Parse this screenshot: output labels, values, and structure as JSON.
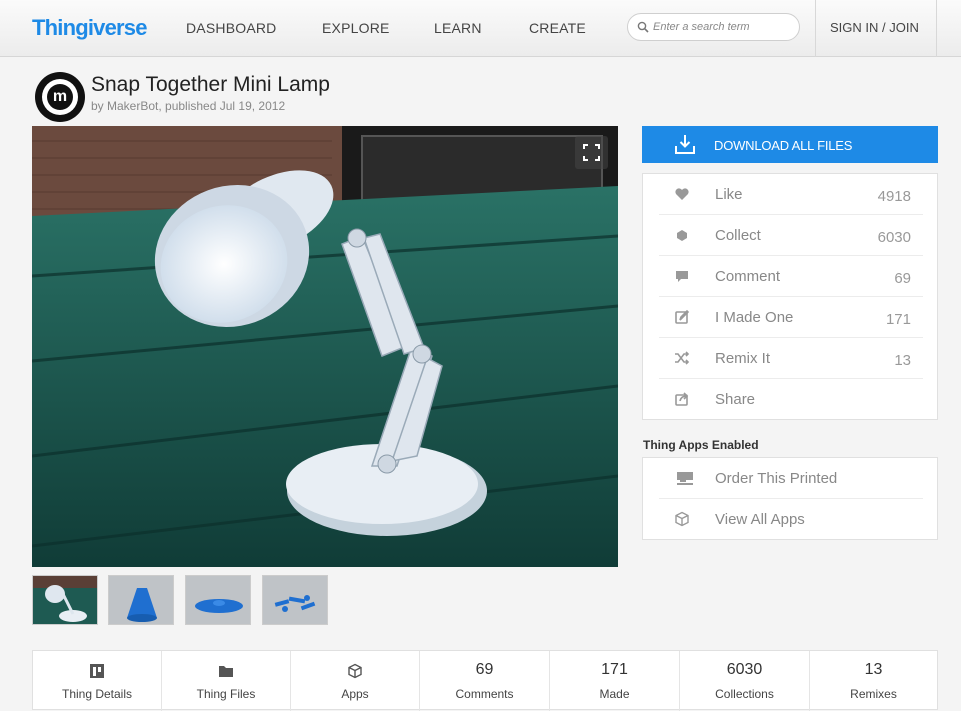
{
  "header": {
    "logo": "Thingiverse",
    "nav": [
      "DASHBOARD",
      "EXPLORE",
      "LEARN",
      "CREATE"
    ],
    "search_placeholder": "Enter a search term",
    "signin": "SIGN IN / JOIN"
  },
  "thing": {
    "title": "Snap Together Mini Lamp",
    "byline": "by MakerBot, published Jul 19, 2012",
    "avatar_letter": "m"
  },
  "download": {
    "label": "DOWNLOAD ALL FILES"
  },
  "stats": [
    {
      "icon": "heart-icon",
      "label": "Like",
      "count": "4918"
    },
    {
      "icon": "collect-icon",
      "label": "Collect",
      "count": "6030"
    },
    {
      "icon": "comment-icon",
      "label": "Comment",
      "count": "69"
    },
    {
      "icon": "made-icon",
      "label": "I Made One",
      "count": "171"
    },
    {
      "icon": "remix-icon",
      "label": "Remix It",
      "count": "13"
    },
    {
      "icon": "share-icon",
      "label": "Share",
      "count": ""
    }
  ],
  "apps": {
    "heading": "Thing Apps Enabled",
    "items": [
      {
        "icon": "printer-icon",
        "label": "Order This Printed"
      },
      {
        "icon": "cube-icon",
        "label": "View All Apps"
      }
    ]
  },
  "tabs": [
    {
      "icon": "thing-details-icon",
      "label": "Thing Details"
    },
    {
      "icon": "thing-files-icon",
      "label": "Thing Files"
    },
    {
      "icon": "apps-icon",
      "label": "Apps"
    },
    {
      "number": "69",
      "label": "Comments"
    },
    {
      "number": "171",
      "label": "Made"
    },
    {
      "number": "6030",
      "label": "Collections"
    },
    {
      "number": "13",
      "label": "Remixes"
    }
  ],
  "colors": {
    "brand": "#1e8ae6",
    "text_muted": "#888888"
  }
}
